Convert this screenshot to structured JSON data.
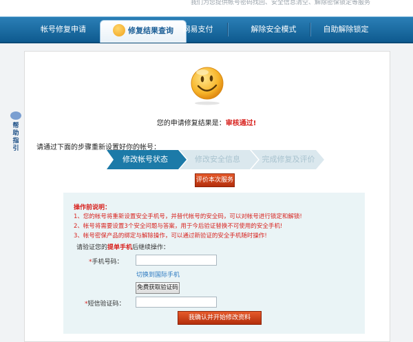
{
  "header": {
    "top_note": "我们为您提供帐号密码找回、安全信息清空、解除密保锁定等服务"
  },
  "nav": {
    "items": [
      "帐号修复申请",
      "修复结果查询",
      "网易支付",
      "解除安全模式",
      "自助解除锁定"
    ],
    "active": "修复结果查询"
  },
  "help": {
    "label": "帮助指引"
  },
  "result": {
    "prefix": "您的申请修复结果是：",
    "status": "审核通过!"
  },
  "steps": {
    "intro": "请通过下面的步骤重新设置好你的帐号：",
    "items": [
      {
        "label": "修改帐号状态",
        "state": "active"
      },
      {
        "label": "修改安全信息",
        "state": "pending"
      },
      {
        "label": "完成修复及评价",
        "state": "pending"
      }
    ]
  },
  "eval_button": "评价本次服务",
  "instructions": {
    "title": "操作前说明：",
    "notes": [
      "1、您的帐号将重新设置安全手机号，并替代帐号的安全码，可以对帐号进行锁定和解锁!",
      "2、帐号将需要设置3个安全问题与答案，用于今后验证替换不可使用的安全手机!",
      "3、帐号密保产品的绑定与解除操作，可以通过新验证的安全手机随时操作!"
    ],
    "verify_prefix": "请验证您的",
    "verify_highlight": "提单手机",
    "verify_suffix": "后继续操作："
  },
  "form": {
    "phone_label": "手机号码：",
    "phone_value": "",
    "intl_link": "切换到国际手机",
    "get_code_button": "免费获取验证码",
    "sms_label": "短信验证码：",
    "sms_value": "",
    "required_mark": "*",
    "submit_button": "我确认并开始修改资料"
  },
  "colors": {
    "nav_bg": "#1a6aa3",
    "accent_red": "#d8231f",
    "step_active": "#1c7aa8",
    "step_pending": "#dbe8ee",
    "button_orange": "#cc4318",
    "form_bg": "#eaf4f6"
  }
}
